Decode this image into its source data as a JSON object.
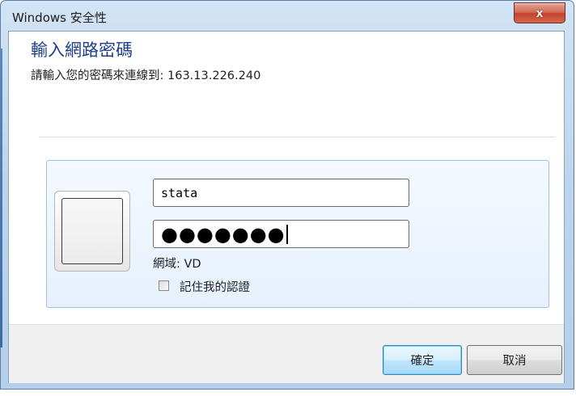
{
  "window": {
    "title": "Windows 安全性",
    "close_label": "x"
  },
  "dialog": {
    "heading": "輸入網路密碼",
    "subtitle": "請輸入您的密碼來連線到: 163.13.226.240"
  },
  "credentials": {
    "username_value": "stata",
    "password_masked": "●●●●●●●",
    "domain_text": "網域: VD",
    "remember_label": "記住我的認證",
    "remember_checked": false
  },
  "buttons": {
    "ok_label": "確定",
    "cancel_label": "取消"
  },
  "colors": {
    "heading": "#1e3f87",
    "panel_border": "#9bc1e5",
    "close_button": "#c2432a",
    "default_button_border": "#3c7fb1"
  }
}
